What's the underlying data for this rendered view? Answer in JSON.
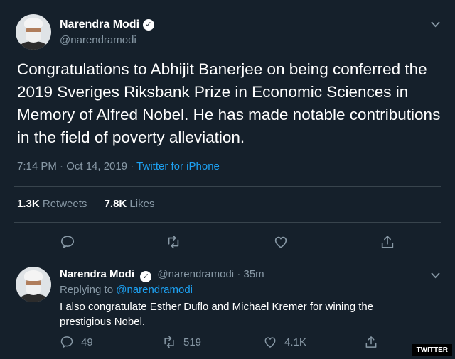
{
  "main_tweet": {
    "author_name": "Narendra Modi",
    "author_handle": "@narendramodi",
    "text": "Congratulations to Abhijit Banerjee on being conferred the 2019 Sveriges Riksbank Prize in Economic Sciences in Memory of Alfred Nobel. He has made notable contributions in the field of poverty alleviation.",
    "timestamp": "7:14 PM · Oct 14, 2019 · ",
    "source": "Twitter for iPhone",
    "retweets_count": "1.3K",
    "retweets_label": "Retweets",
    "likes_count": "7.8K",
    "likes_label": "Likes"
  },
  "reply_tweet": {
    "author_name": "Narendra Modi",
    "author_handle": "@narendramodi",
    "time_ago": "· 35m",
    "replying_to_label": "Replying to",
    "replying_to_handle": "@narendramodi",
    "text": "I also congratulate Esther Duflo and Michael Kremer for wining the prestigious Nobel.",
    "reply_count": "49",
    "retweet_count": "519",
    "like_count": "4.1K"
  },
  "watermark": "TWITTER",
  "colors": {
    "background": "#15202b",
    "secondary_text": "#8899a6",
    "link": "#1da1f2",
    "divider": "#38444d"
  },
  "icons": [
    "verified-icon",
    "chevron-down-icon",
    "reply-icon",
    "retweet-icon",
    "like-icon",
    "share-icon"
  ]
}
